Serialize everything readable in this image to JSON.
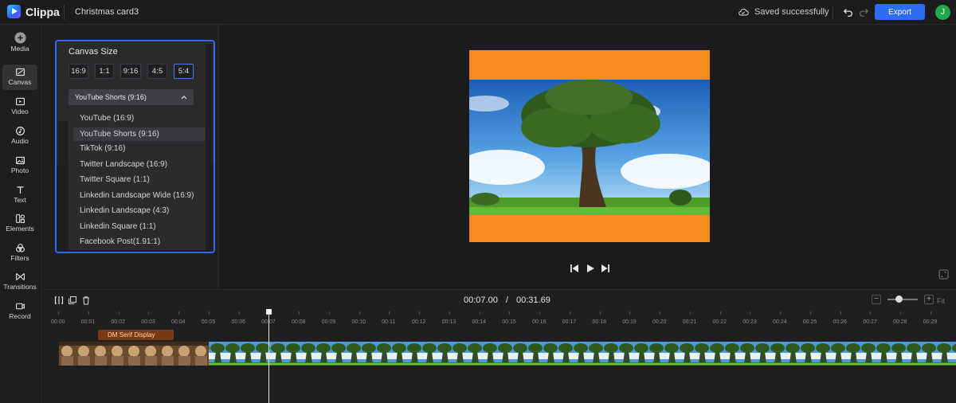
{
  "app": {
    "name": "Clippa",
    "project_title": "Christmas card3"
  },
  "header": {
    "save_status": "Saved successfully",
    "export_label": "Export",
    "avatar_initial": "J"
  },
  "sidebar": {
    "items": [
      {
        "label": "Media",
        "icon": "plus-circle-icon"
      },
      {
        "label": "Canvas",
        "icon": "canvas-icon"
      },
      {
        "label": "Video",
        "icon": "video-icon"
      },
      {
        "label": "Audio",
        "icon": "audio-icon"
      },
      {
        "label": "Photo",
        "icon": "photo-icon"
      },
      {
        "label": "Text",
        "icon": "text-icon"
      },
      {
        "label": "Elements",
        "icon": "elements-icon"
      },
      {
        "label": "Filters",
        "icon": "filters-icon"
      },
      {
        "label": "Transitions",
        "icon": "transitions-icon"
      },
      {
        "label": "Record",
        "icon": "record-icon"
      }
    ],
    "active": "Canvas"
  },
  "canvas_panel": {
    "title": "Canvas Size",
    "ratios": [
      "16:9",
      "1:1",
      "9:16",
      "4:5",
      "5:4"
    ],
    "selected_ratio": "5:4",
    "preset_selected": "YouTube Shorts (9:16)",
    "presets": [
      "YouTube (16:9)",
      "YouTube Shorts (9:16)",
      "TikTok (9:16)",
      "Twitter Landscape (16:9)",
      "Twitter Square (1:1)",
      "Linkedin Landscape Wide (16:9)",
      "Linkedin Landscape (4:3)",
      "Linkedin Square (1:1)",
      "Facebook Post(1.91:1)"
    ]
  },
  "timeline": {
    "current_time": "00:07.00",
    "separator": "/",
    "total_time": "00:31.69",
    "fit_label": "Fit",
    "ticks": [
      "00:00",
      "00:01",
      "00:02",
      "00:03",
      "00:04",
      "00:05",
      "00:06",
      "00:07",
      "00:08",
      "00:09",
      "00:10",
      "00:11",
      "00:12",
      "00:13",
      "00:14",
      "00:15",
      "00:16",
      "00:17",
      "00:18",
      "00:19",
      "00:20",
      "00:21",
      "00:22",
      "00:23",
      "00:24",
      "00:25",
      "00:26",
      "00:27",
      "00:28",
      "00:29"
    ],
    "text_clip_label": "DM Serif Display"
  },
  "colors": {
    "accent": "#2f6cf5",
    "canvas_background": "#f68c1e",
    "avatar": "#21a84a"
  }
}
